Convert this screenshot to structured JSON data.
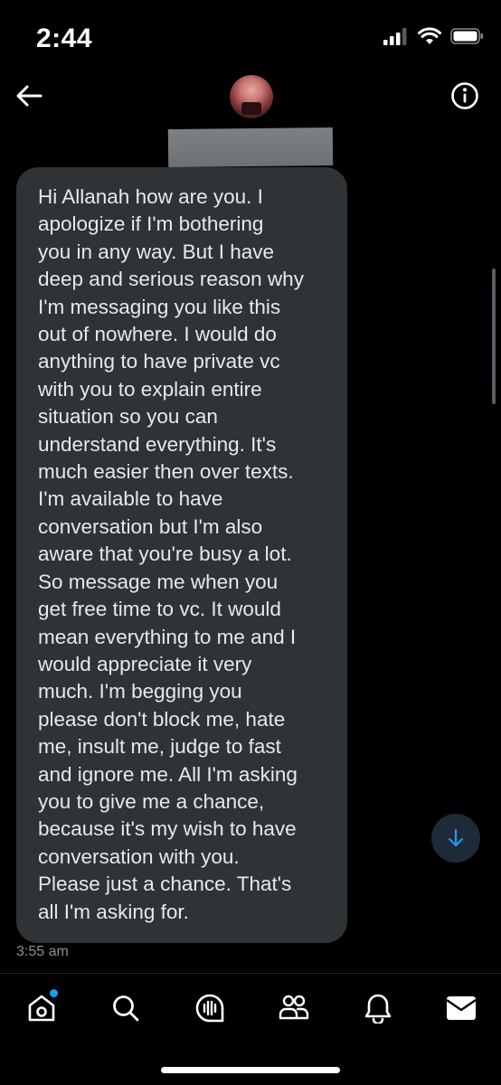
{
  "status_bar": {
    "time": "2:44"
  },
  "header": {
    "back_icon": "arrow-left-icon",
    "info_icon": "info-circle-icon",
    "contact_name_redacted": true
  },
  "message": {
    "text": "Hi Allanah how are you. I\napologize if I'm bothering\nyou in any way. But I have\ndeep and serious reason why\nI'm messaging you like this\nout of nowhere. I would do\nanything to have private vc\nwith you to explain entire\nsituation so you can\nunderstand everything. It's\nmuch easier then over texts.\nI'm available to have\nconversation but I'm also\naware that you're busy a lot.\nSo message me when you\nget free time to vc. It would\nmean everything to me and I\nwould appreciate it very\nmuch. I'm begging you\nplease don't block me, hate\nme, insult me, judge to fast\nand ignore me. All I'm asking\nyou to give me a chance,\nbecause it's my wish to have\nconversation with you.\nPlease just a chance. That's\nall I'm asking for.",
    "timestamp": "3:55 am"
  },
  "bottom_nav": {
    "items": [
      "home-icon",
      "search-icon",
      "spaces-icon",
      "communities-icon",
      "notifications-icon",
      "messages-icon"
    ],
    "home_has_notification": true
  },
  "colors": {
    "background": "#000000",
    "bubble": "#2f3336",
    "accent": "#1d9bf0",
    "text": "#e7e9ea",
    "muted": "#8b8f94"
  }
}
